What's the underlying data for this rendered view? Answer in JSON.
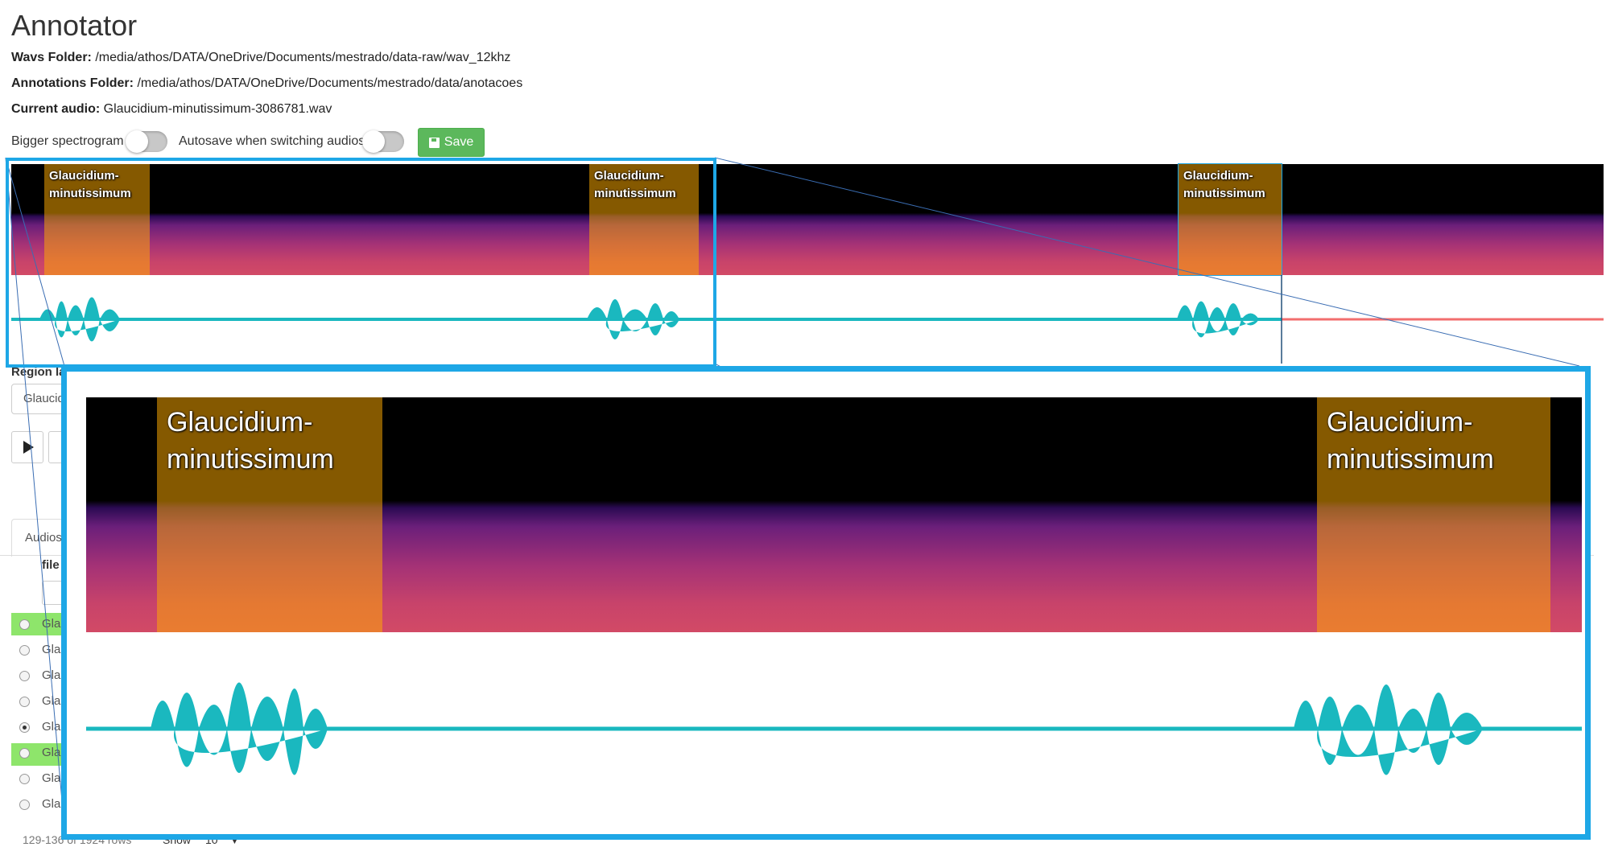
{
  "app": {
    "title": "Annotator"
  },
  "info": {
    "wavs_label": "Wavs Folder:",
    "wavs_value": "/media/athos/DATA/OneDrive/Documents/mestrado/data-raw/wav_12khz",
    "annotations_label": "Annotations Folder:",
    "annotations_value": "/media/athos/DATA/OneDrive/Documents/mestrado/data/anotacoes",
    "current_label": "Current audio:",
    "current_value": "Glaucidium-minutissimum-3086781.wav"
  },
  "controls": {
    "bigger_spectrogram_label": "Bigger spectrogram",
    "autosave_label": "Autosave when switching audios",
    "save_label": "Save"
  },
  "regions": {
    "label_line1": "Glaucidium-",
    "label_line2": "minutissimum"
  },
  "left_panel": {
    "region_label": "Region label",
    "region_input_value": "Glaucidium-minutissimum",
    "tab_audios": "Audios",
    "col_file": "file",
    "rows": [
      "Glaucidium-minutissimum",
      "Glaucidium-minutissimum",
      "Glaucidium-minutissimum",
      "Glaucidium-minutissimum",
      "Glaucidium-minutissimum",
      "Glaucidium-minutissimum",
      "Glaucidium-minutissimum",
      "Glaucidium-minutissimum"
    ]
  },
  "pagination": {
    "rows_text": "129-136 of 1924 rows",
    "show_label": "Show",
    "page_size": "10"
  },
  "colors": {
    "accent_blue": "#1ea7e6",
    "waveform": "#1ab8bf",
    "waveform_unplayed": "#f26d6d",
    "save_green": "#5cb85c",
    "region": "#ffaa00"
  }
}
